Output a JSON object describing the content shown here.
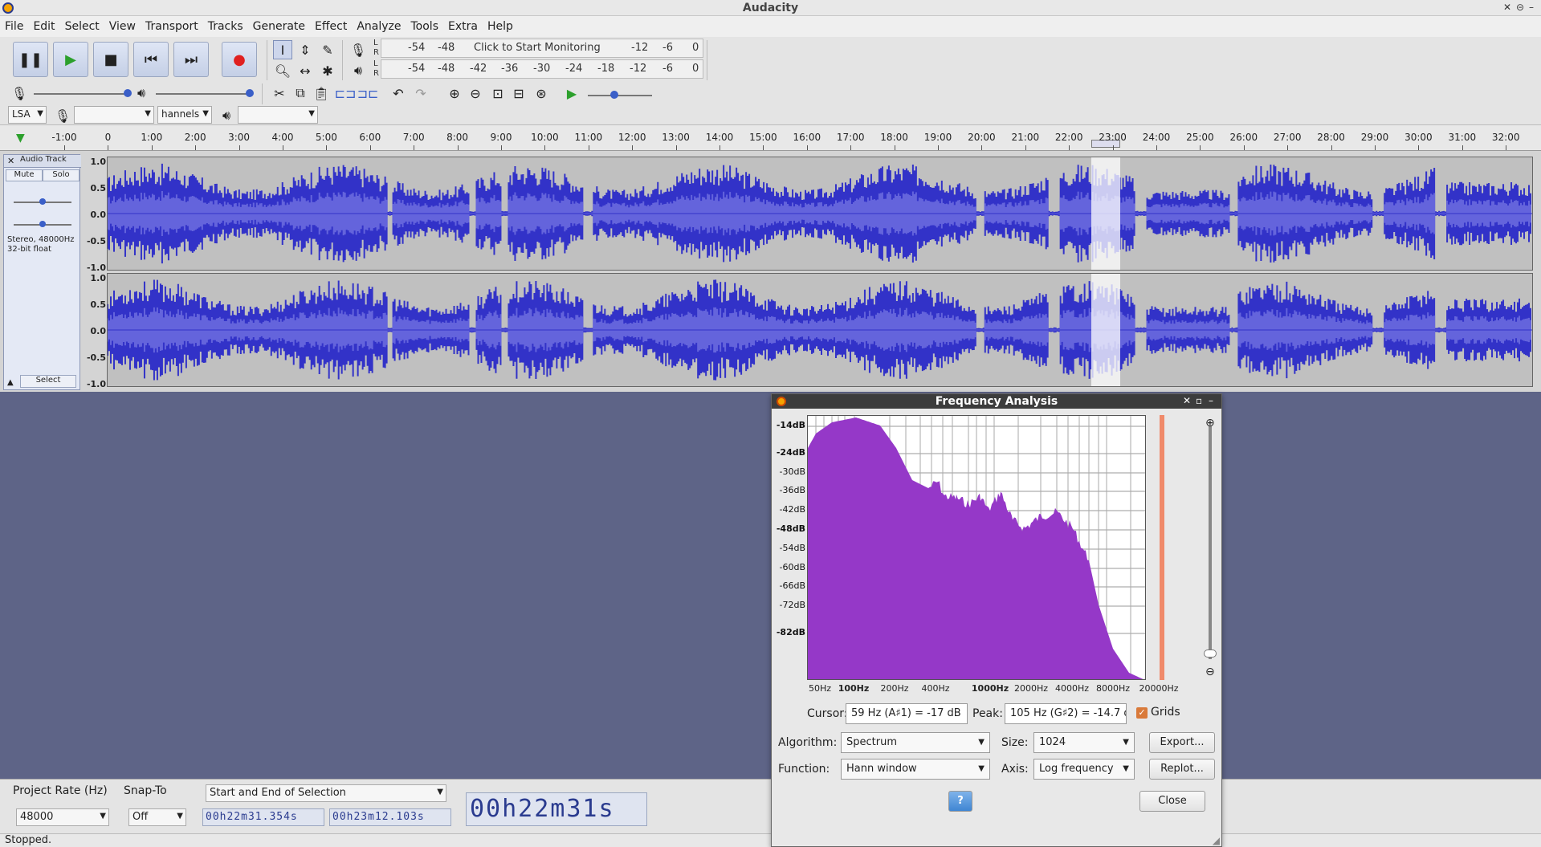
{
  "window": {
    "title": "Audacity"
  },
  "menu": [
    "File",
    "Edit",
    "Select",
    "View",
    "Transport",
    "Tracks",
    "Generate",
    "Effect",
    "Analyze",
    "Tools",
    "Extra",
    "Help"
  ],
  "meters": {
    "record_scale": [
      "-54",
      "-48",
      "Click to Start Monitoring",
      "-12",
      "-6",
      "0"
    ],
    "play_scale": [
      "-54",
      "-48",
      "-42",
      "-36",
      "-30",
      "-24",
      "-18",
      "-12",
      "-6",
      "0"
    ],
    "channel_l": "L",
    "channel_r": "R"
  },
  "device": {
    "host": "LSA",
    "channels": "hannels"
  },
  "ruler_ticks": [
    "-1:00",
    "0",
    "1:00",
    "2:00",
    "3:00",
    "4:00",
    "5:00",
    "6:00",
    "7:00",
    "8:00",
    "9:00",
    "10:00",
    "11:00",
    "12:00",
    "13:00",
    "14:00",
    "15:00",
    "16:00",
    "17:00",
    "18:00",
    "19:00",
    "20:00",
    "21:00",
    "22:00",
    "23:00",
    "24:00",
    "25:00",
    "26:00",
    "27:00",
    "28:00",
    "29:00",
    "30:00",
    "31:00",
    "32:00"
  ],
  "track": {
    "name": "Audio Track",
    "mute": "Mute",
    "solo": "Solo",
    "info_line1": "Stereo, 48000Hz",
    "info_line2": "32-bit float",
    "select": "Select",
    "scale": [
      "1.0",
      "0.5",
      "0.0",
      "-0.5",
      "-1.0"
    ]
  },
  "selection_toolbar": {
    "project_rate_label": "Project Rate (Hz)",
    "project_rate": "48000",
    "snap_label": "Snap-To",
    "snap": "Off",
    "mode": "Start and End of Selection",
    "start": "00h22m31.354s",
    "end": "00h23m12.103s",
    "audio_position": "00h22m31s"
  },
  "status": "Stopped.",
  "dialog": {
    "title": "Frequency Analysis",
    "db_labels": [
      "-14dB",
      "-24dB",
      "-30dB",
      "-36dB",
      "-42dB",
      "-48dB",
      "-54dB",
      "-60dB",
      "-66dB",
      "-72dB",
      "-82dB"
    ],
    "hz_labels": [
      "50Hz",
      "100Hz",
      "200Hz",
      "400Hz",
      "1000Hz",
      "2000Hz",
      "4000Hz",
      "8000Hz",
      "20000Hz"
    ],
    "cursor_label": "Cursor:",
    "cursor_value": "59 Hz (A♯1) = -17 dB",
    "peak_label": "Peak:",
    "peak_value": "105 Hz (G♯2) = -14.7 d",
    "grids_label": "Grids",
    "grids_checked": true,
    "algorithm_label": "Algorithm:",
    "algorithm": "Spectrum",
    "size_label": "Size:",
    "size": "1024",
    "function_label": "Function:",
    "function": "Hann window",
    "axis_label": "Axis:",
    "axis": "Log frequency",
    "export": "Export...",
    "replot": "Replot...",
    "help": "?",
    "close": "Close"
  },
  "colors": {
    "waveform": "#3232c8",
    "waveform_rms": "#6464dc",
    "spectrum": "#9538c8",
    "workspace": "#5e6487"
  }
}
